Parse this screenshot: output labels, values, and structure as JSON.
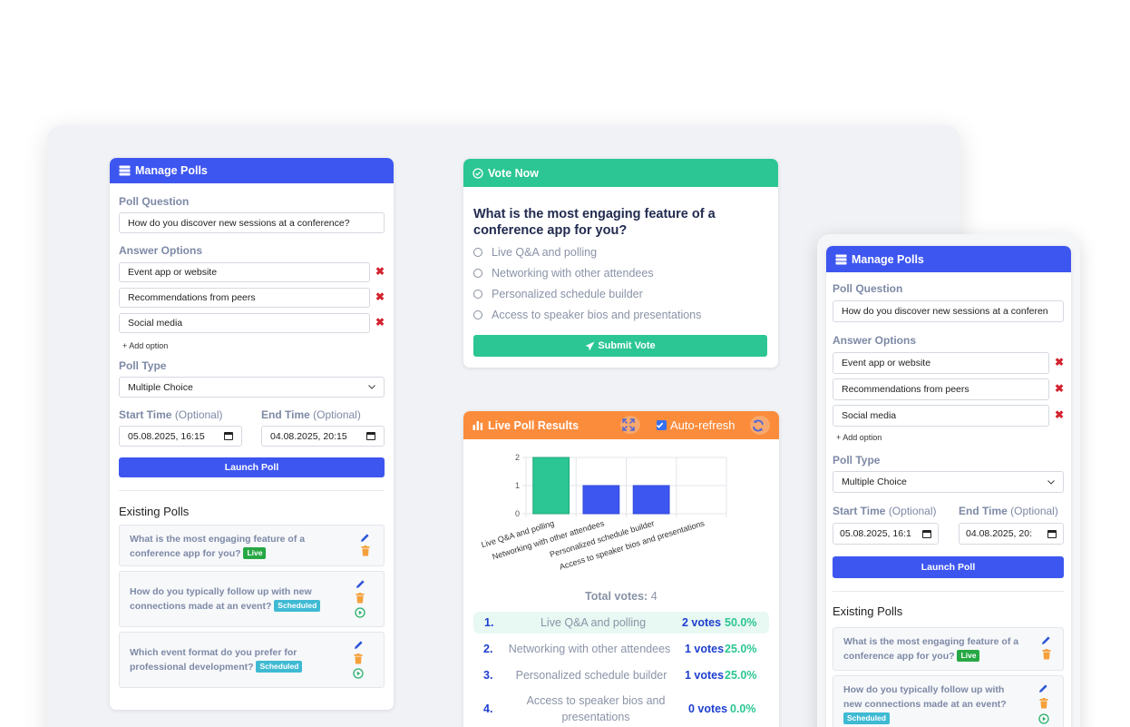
{
  "manage": {
    "title": "Manage Polls",
    "question_label": "Poll Question",
    "question_value": "How do you discover new sessions at a conference?",
    "options_label": "Answer Options",
    "options": [
      "Event app or website",
      "Recommendations from peers",
      "Social media"
    ],
    "remove_symbol": "✖",
    "add_option": "+ Add option",
    "type_label": "Poll Type",
    "type_value": "Multiple Choice",
    "start_label": "Start Time",
    "end_label": "End Time",
    "optional": "(Optional)",
    "start_value": "05.08.2025, 16:15",
    "end_value": "04.08.2025, 20:15",
    "launch": "Launch Poll",
    "existing_title": "Existing Polls",
    "existing": [
      {
        "q1": "What is the most engaging feature of a",
        "q2": "conference app for you?",
        "badge": "Live"
      },
      {
        "q1": "How do you typically follow up with new",
        "q2": "connections made at an event?",
        "badge": "Scheduled"
      },
      {
        "q1": "Which event format do you prefer for",
        "q2": "professional development?",
        "badge": "Scheduled"
      }
    ]
  },
  "mobile": {
    "question_value": "How do you discover new sessions at a conferen",
    "start_value": "05.08.2025, 16:1",
    "end_value": "04.08.2025, 20:",
    "existing": [
      {
        "q1": "What is the most engaging feature of a",
        "q2": "conference app for you?",
        "badge": "Live"
      },
      {
        "q1": "How do you typically follow up with",
        "q2": "new connections made at an event?",
        "badge": "Scheduled"
      }
    ]
  },
  "vote": {
    "title": "Vote Now",
    "question_l1": "What is the most engaging feature of a",
    "question_l2": "conference app for you?",
    "options": [
      "Live Q&A and polling",
      "Networking with other attendees",
      "Personalized schedule builder",
      "Access to speaker bios and presentations"
    ],
    "submit": "Submit Vote"
  },
  "results": {
    "title": "Live Poll Results",
    "auto_refresh": "Auto-refresh",
    "total_label": "Total votes:",
    "total": "4",
    "rows": [
      {
        "rank": "1.",
        "label": "Live Q&A and polling",
        "votes": "2 votes",
        "pct": "50.0%"
      },
      {
        "rank": "2.",
        "label": "Networking with other attendees",
        "votes": "1 votes",
        "pct": "25.0%"
      },
      {
        "rank": "3.",
        "label": "Personalized schedule builder",
        "votes": "1 votes",
        "pct": "25.0%"
      },
      {
        "rank": "4.",
        "label": "Access to speaker bios and presentations",
        "votes": "0 votes",
        "pct": "0.0%"
      }
    ]
  },
  "colors": {
    "primary": "#3d56f0",
    "success": "#2bc693",
    "warning": "#fb8c3c",
    "danger": "#d3232f"
  },
  "chart_data": {
    "type": "bar",
    "categories": [
      "Live Q&A and polling",
      "Networking with other attendees",
      "Personalized schedule builder",
      "Access to speaker bios and presentations"
    ],
    "values": [
      2,
      1,
      1,
      0
    ],
    "ylim": [
      0,
      2
    ],
    "yticks": [
      "0",
      "1",
      "2"
    ],
    "grid": true,
    "colors": [
      "#2bc693",
      "#3d56f0",
      "#3d56f0",
      "#3d56f0"
    ]
  }
}
